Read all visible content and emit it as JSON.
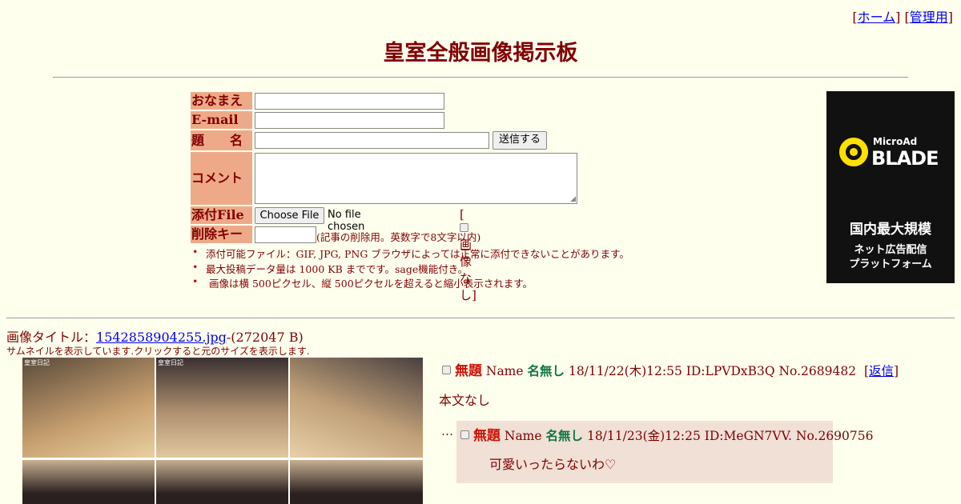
{
  "nav": {
    "home": "ホーム",
    "admin": "管理用"
  },
  "board_title": "皇室全般画像掲示板",
  "form": {
    "name_label": "おなまえ",
    "email_label": "E-mail",
    "subject_label": "題　　名",
    "submit_label": "送信する",
    "comment_label": "コメント",
    "file_label": "添付File",
    "file_button": "Choose File",
    "file_status": "No file chosen",
    "no_image_label": "画像なし",
    "delkey_label": "削除キー",
    "delkey_note": "(記事の削除用。英数字で8文字以内)"
  },
  "notes": [
    "添付可能ファイル：GIF, JPG, PNG ブラウザによっては正常に添付できないことがあります。",
    "最大投稿データ量は 1000 KB までです。sage機能付き。",
    "画像は横 500ピクセル、縦 500ピクセルを超えると縮小表示されます。"
  ],
  "ad": {
    "brand_small": "MicroAd",
    "brand_big": "BLADE",
    "tagline1": "国内最大規模",
    "tagline2": "ネット広告配信",
    "tagline3": "プラットフォーム"
  },
  "post": {
    "image_prefix": "画像タイトル：",
    "image_file": "1542858904255.jpg",
    "image_size": "-(272047 B)",
    "thumb_note": "サムネイルを表示しています.クリックすると元のサイズを表示します.",
    "thumb_caption": "皇室日記",
    "subject": "無題",
    "name_prefix": "Name",
    "name": "名無し",
    "meta": "18/11/22(木)12:55 ID:LPVDxB3Q No.2689482",
    "reply_link": "返信",
    "body": "本文なし"
  },
  "reply": {
    "marker": "…",
    "subject": "無題",
    "name_prefix": "Name",
    "name": "名無し",
    "meta": "18/11/23(金)12:25 ID:MeGN7VV. No.2690756",
    "body": "可愛いったらないわ♡"
  },
  "colors": {
    "background": "#ffffee",
    "text": "#800000",
    "label_bg": "#eeaa88",
    "reply_bg": "#f0e0d6",
    "subject": "#cc1105",
    "name": "#117743"
  }
}
